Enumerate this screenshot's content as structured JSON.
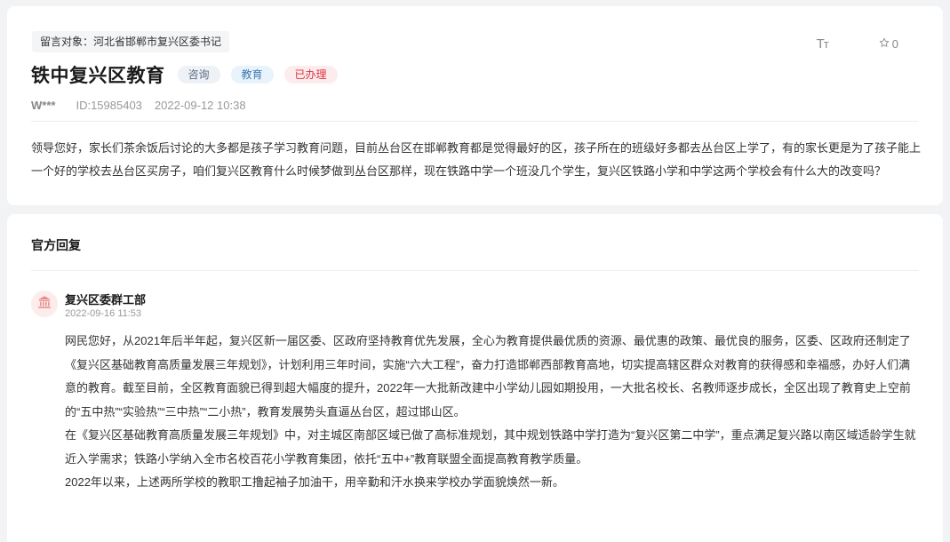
{
  "message": {
    "target_label": "留言对象：河北省邯郸市复兴区委书记",
    "title": "铁中复兴区教育",
    "tags": [
      "咨询",
      "教育",
      "已办理"
    ],
    "author": "W***",
    "id_text": "ID:15985403",
    "time": "2022-09-12 10:38",
    "font_size_icon": "Tт",
    "star_count": "0",
    "body": "领导您好，家长们茶余饭后讨论的大多都是孩子学习教育问题，目前丛台区在邯郸教育都是觉得最好的区，孩子所在的班级好多都去丛台区上学了，有的家长更是为了孩子能上一个好的学校去丛台区买房子，咱们复兴区教育什么时候梦做到丛台区那样，现在铁路中学一个班没几个学生，复兴区铁路小学和中学这两个学校会有什么大的改变吗？"
  },
  "reply": {
    "heading": "官方回复",
    "department": "复兴区委群工部",
    "time": "2022-09-16 11:53",
    "paragraphs": [
      "网民您好，从2021年后半年起，复兴区新一届区委、区政府坚持教育优先发展，全心为教育提供最优质的资源、最优惠的政策、最优良的服务，区委、区政府还制定了《复兴区基础教育高质量发展三年规划》，计划利用三年时间，实施“六大工程”，奋力打造邯郸西部教育高地，切实提高辖区群众对教育的获得感和幸福感，办好人们满意的教育。截至目前，全区教育面貌已得到超大幅度的提升，2022年一大批新改建中小学幼儿园如期投用，一大批名校长、名教师逐步成长，全区出现了教育史上空前的“五中热”“实验热”“三中热”“二小热”，教育发展势头直逼丛台区，超过邯山区。",
      "在《复兴区基础教育高质量发展三年规划》中，对主城区南部区域已做了高标准规划，其中规划铁路中学打造为“复兴区第二中学”，重点满足复兴路以南区域适龄学生就近入学需求；铁路小学纳入全市名校百花小学教育集团，依托“五中+”教育联盟全面提高教育教学质量。",
      "2022年以来，上述两所学校的教职工撸起袖子加油干，用辛勤和汗水换来学校办学面貌焕然一新。"
    ]
  },
  "icons": {
    "font_size": "font-size-icon",
    "star": "star-outline-icon",
    "avatar": "government-building-icon"
  },
  "colors": {
    "tag_status": "#e0313b",
    "tag_edu": "#3d7ab5",
    "avatar_icon": "#e88a8a"
  }
}
